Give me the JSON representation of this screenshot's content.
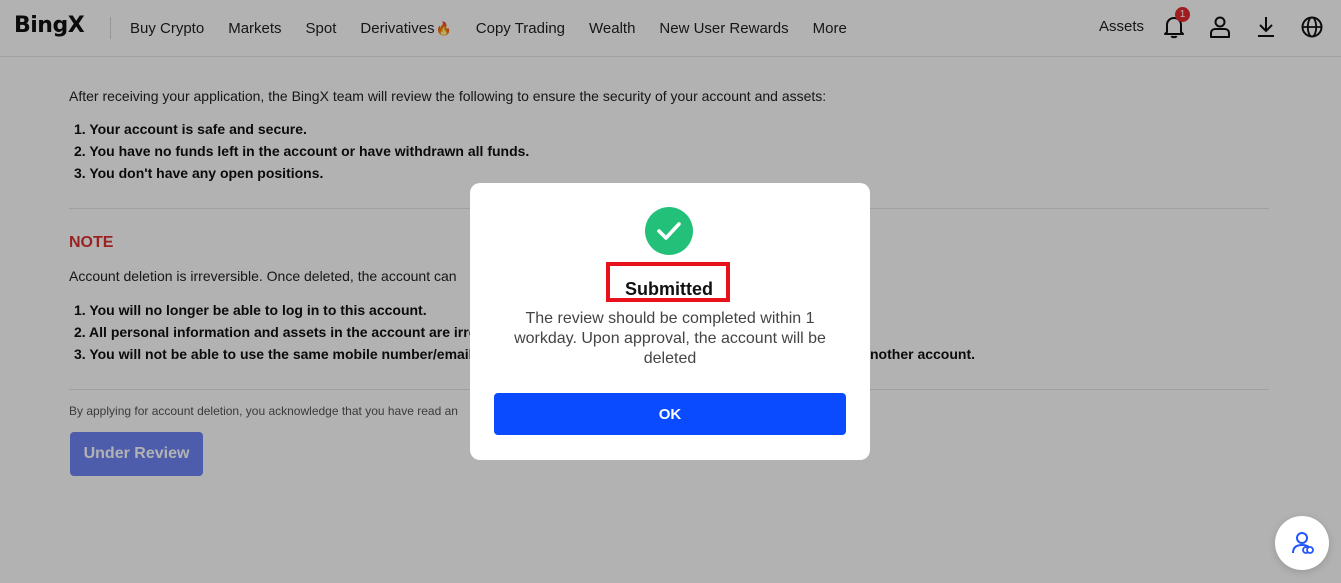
{
  "header": {
    "logo": "BingX",
    "nav": [
      {
        "label": "Buy Crypto"
      },
      {
        "label": "Markets"
      },
      {
        "label": "Spot"
      },
      {
        "label": "Derivatives",
        "icon": "fire-icon"
      },
      {
        "label": "Copy Trading"
      },
      {
        "label": "Wealth"
      },
      {
        "label": "New User Rewards"
      },
      {
        "label": "More"
      }
    ],
    "assets_label": "Assets",
    "notification_count": "1",
    "icons": [
      "bell-icon",
      "user-icon",
      "download-icon",
      "globe-icon"
    ]
  },
  "main": {
    "intro": "After receiving your application, the BingX team will review the following to ensure the security of your account and assets:",
    "review_items": [
      "1. Your account is safe and secure.",
      "2. You have no funds left in the account or have withdrawn all funds.",
      "3. You don't have any open positions."
    ],
    "note_title": "NOTE",
    "note_text": "Account deletion is irreversible. Once deleted, the account can",
    "consequences": [
      "1. You will no longer be able to log in to this account.",
      "2. All personal information and assets in the account are irre",
      "3. You will not be able to use the same mobile number/email"
    ],
    "consequence3_tail": "nother account.",
    "acknowledgement": "By applying for account deletion, you acknowledge that you have read an",
    "status_button": "Under Review"
  },
  "modal": {
    "icon": "check-icon",
    "title": "Submitted",
    "description": "The review should be completed within 1 workday. Upon approval, the account will be deleted",
    "ok_label": "OK"
  },
  "colors": {
    "accent": "#0a4bff",
    "success": "#23c07a",
    "note": "#e03131",
    "highlight_box": "#e8101b"
  }
}
